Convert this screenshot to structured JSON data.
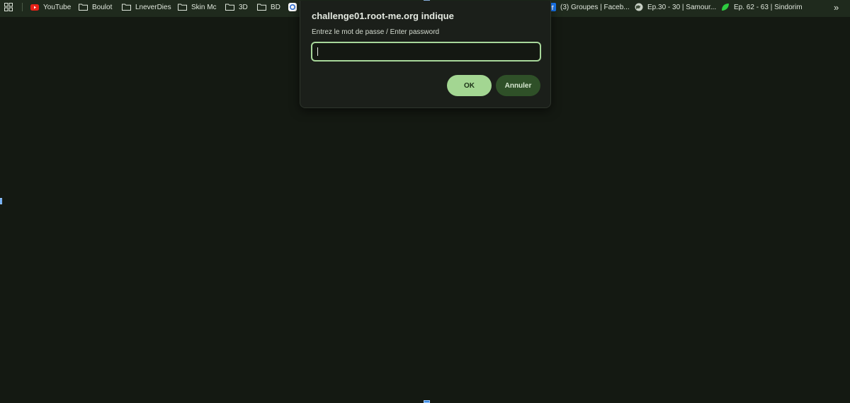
{
  "bookmarks": {
    "items": [
      {
        "label": "YouTube",
        "icon": "youtube-icon"
      },
      {
        "label": "Boulot",
        "icon": "folder-icon"
      },
      {
        "label": "LneverDies",
        "icon": "folder-icon"
      },
      {
        "label": "Skin Mc",
        "icon": "folder-icon"
      },
      {
        "label": "3D",
        "icon": "folder-icon"
      },
      {
        "label": "BD",
        "icon": "folder-icon"
      },
      {
        "label": "(3) Groupes | Faceb...",
        "icon": "facebook-icon"
      },
      {
        "label": "Ep.30 - 30 | Samour...",
        "icon": "globe-icon"
      },
      {
        "label": "Ep. 62 - 63 | Sindorim",
        "icon": "green-leaf-icon"
      }
    ],
    "overflow_label": "»"
  },
  "dialog": {
    "title": "challenge01.root-me.org indique",
    "message": "Entrez le mot de passe / Enter password",
    "input_value": "",
    "ok_label": "OK",
    "cancel_label": "Annuler"
  },
  "colors": {
    "page_background": "#141912",
    "bookmarks_bar": "#1f2a1d",
    "dialog_background": "#1b1f1a",
    "accent": "#a3d692",
    "secondary_button": "#2f5028"
  }
}
